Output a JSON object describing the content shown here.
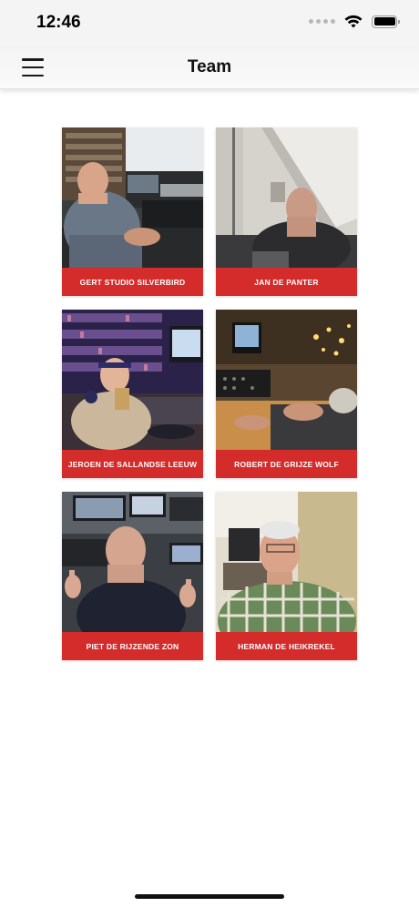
{
  "status_bar": {
    "time": "12:46"
  },
  "nav": {
    "title": "Team",
    "menu_icon": "hamburger-menu-icon"
  },
  "accent_color": "#d42b2b",
  "team": [
    {
      "name": "GERT STUDIO SILVERBIRD"
    },
    {
      "name": "JAN DE PANTER"
    },
    {
      "name": "JEROEN DE SALLANDSE LEEUW"
    },
    {
      "name": "ROBERT DE GRIJZE WOLF"
    },
    {
      "name": "PIET DE RIJZENDE ZON"
    },
    {
      "name": "HERMAN DE HEIKREKEL"
    }
  ]
}
